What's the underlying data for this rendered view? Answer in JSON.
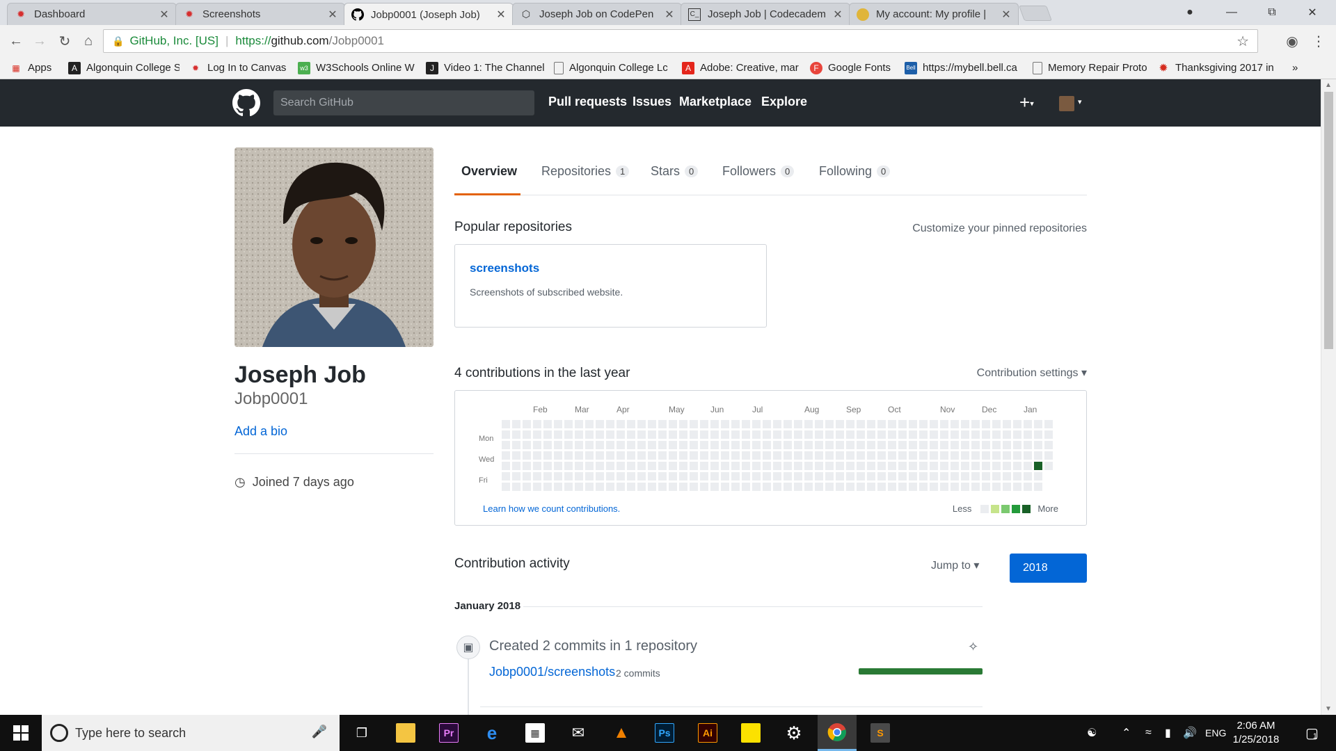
{
  "browser": {
    "tabs": [
      {
        "label": "Dashboard",
        "icon": "canvas-icon",
        "active": false
      },
      {
        "label": "Screenshots",
        "icon": "canvas-icon",
        "active": false
      },
      {
        "label": "Jobp0001 (Joseph Job)",
        "icon": "github-icon",
        "active": true
      },
      {
        "label": "Joseph Job on CodePen",
        "icon": "codepen-icon",
        "active": false
      },
      {
        "label": "Joseph Job | Codecadem",
        "icon": "codecademy-icon",
        "active": false
      },
      {
        "label": "My account: My profile |",
        "icon": "profile-icon",
        "active": false
      }
    ],
    "address": {
      "cert": "GitHub, Inc. [US]",
      "scheme": "https://",
      "host": "github.com",
      "path": "/Jobp0001"
    },
    "bookmarks": [
      {
        "label": "Apps",
        "icon": "apps-grid-icon"
      },
      {
        "label": "Algonquin College St",
        "icon": "algonquin-icon"
      },
      {
        "label": "Log In to Canvas",
        "icon": "canvas-icon"
      },
      {
        "label": "W3Schools Online W",
        "icon": "w3schools-icon"
      },
      {
        "label": "Video 1: The Channel",
        "icon": "video-icon"
      },
      {
        "label": "Algonquin College Lc",
        "icon": "page-icon"
      },
      {
        "label": "Adobe: Creative, mar",
        "icon": "adobe-icon"
      },
      {
        "label": "Google Fonts",
        "icon": "google-fonts-icon"
      },
      {
        "label": "https://mybell.bell.ca",
        "icon": "bell-icon"
      },
      {
        "label": "Memory Repair Proto",
        "icon": "page-icon"
      },
      {
        "label": "Thanksgiving 2017 in",
        "icon": "cbc-icon"
      }
    ]
  },
  "github": {
    "search_placeholder": "Search GitHub",
    "nav": [
      "Pull requests",
      "Issues",
      "Marketplace",
      "Explore"
    ],
    "profile": {
      "name": "Joseph Job",
      "login": "Jobp0001",
      "add_bio": "Add a bio",
      "joined": "Joined 7 days ago"
    },
    "tabs": [
      {
        "label": "Overview",
        "count": null
      },
      {
        "label": "Repositories",
        "count": "1"
      },
      {
        "label": "Stars",
        "count": "0"
      },
      {
        "label": "Followers",
        "count": "0"
      },
      {
        "label": "Following",
        "count": "0"
      }
    ],
    "popular": {
      "title": "Popular repositories",
      "customize": "Customize your pinned repositories",
      "repo_name": "screenshots",
      "repo_desc": "Screenshots of subscribed website."
    },
    "contributions": {
      "title": "4 contributions in the last year",
      "settings": "Contribution settings ▾",
      "months": [
        "Feb",
        "Mar",
        "Apr",
        "May",
        "Jun",
        "Jul",
        "Aug",
        "Sep",
        "Oct",
        "Nov",
        "Dec",
        "Jan"
      ],
      "weekdays": [
        "Mon",
        "Wed",
        "Fri"
      ],
      "learn": "Learn how we count contributions.",
      "less": "Less",
      "more": "More",
      "weeks": 53,
      "last_week_days": 5,
      "active_cell": {
        "week": 51,
        "day": 4,
        "level": 4
      },
      "colors": [
        "#ebedf0",
        "#c6e48b",
        "#7bc96f",
        "#239a3b",
        "#196127"
      ]
    },
    "activity": {
      "title": "Contribution activity",
      "jump_to": "Jump to ▾",
      "year": "2018",
      "month_header": "January 2018",
      "event_title": "Created 2 commits in 1 repository",
      "repo": "Jobp0001/screenshots",
      "commits": "2 commits",
      "commit_fraction": 1.0
    }
  },
  "taskbar": {
    "search_placeholder": "Type here to search",
    "apps": [
      "task-view-icon",
      "file-explorer-icon",
      "premiere-icon",
      "edge-icon",
      "store-icon",
      "mail-icon",
      "vlc-icon",
      "photoshop-icon",
      "illustrator-icon",
      "sticky-notes-icon",
      "settings-icon",
      "chrome-icon",
      "sublime-icon"
    ],
    "lang": "ENG",
    "time": "2:06 AM",
    "date": "1/25/2018",
    "notifications": "1"
  }
}
